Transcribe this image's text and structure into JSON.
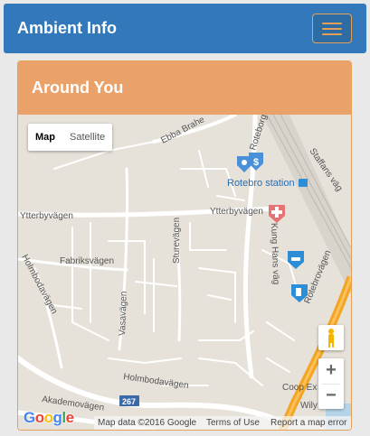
{
  "navbar": {
    "brand": "Ambient Info",
    "toggle_icon": "hamburger-menu-icon",
    "accent": "#e5a257",
    "background": "#3378ba"
  },
  "panel": {
    "title": "Around You",
    "header_color": "#eba26a"
  },
  "map": {
    "type_control": {
      "map_label": "Map",
      "satellite_label": "Satellite",
      "selected": "Map"
    },
    "zoom_in_label": "+",
    "zoom_out_label": "−",
    "street_labels": {
      "ebba_brahe": "Ebba Brahe",
      "roteborgvagen": "Roteborgvägen",
      "staffans_vag": "Staffans väg",
      "rotebro_station": "Rotebro station",
      "ytterbyvagen_left": "Ytterbyvägen",
      "ytterbyvagen_right": "Ytterbyvägen",
      "fabriksvagen": "Fabriksvägen",
      "sturevagen": "Sturevägen",
      "kung_hans_vag": "Kung Hans väg",
      "holmbodavagen_left": "Holmbodavägen",
      "vasavagen": "Vasavägen",
      "rotebrovagen": "Rotebrovägen",
      "holmbodavagen_bottom": "Holmbodavägen",
      "akademovagen": "Akademovägen",
      "route_267": "267",
      "coop": "Coop Ex",
      "wily": "Wily"
    },
    "pois": [
      "dentist-icon",
      "bank-icon",
      "hospital-icon",
      "car-wash-icon",
      "gas-station-icon"
    ],
    "attribution": {
      "logo": "Google",
      "map_data": "Map data ©2016 Google",
      "terms": "Terms of Use",
      "report": "Report a map error"
    }
  }
}
